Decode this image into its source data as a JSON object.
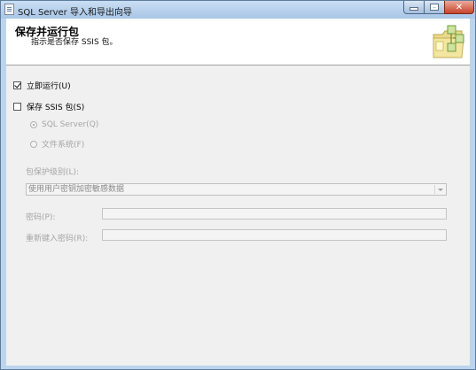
{
  "window": {
    "title": "SQL Server 导入和导出向导",
    "icon": "wizard-app-icon"
  },
  "header": {
    "title": "保存并运行包",
    "subtitle": "指示是否保存 SSIS 包。",
    "icon": "package-folder-icon"
  },
  "options": {
    "run_immediately": {
      "label": "立即运行(U)",
      "checked": true
    },
    "save_package": {
      "label": "保存 SSIS 包(S)",
      "checked": false
    },
    "sql_server": {
      "label": "SQL Server(Q)",
      "selected": true
    },
    "file_system": {
      "label": "文件系统(F)",
      "selected": false
    }
  },
  "protection": {
    "label": "包保护级别(L):",
    "selected": "使用用户密钥加密敏感数据"
  },
  "password": {
    "label": "密码(P):",
    "value": ""
  },
  "retype_password": {
    "label": "重新键入密码(R):",
    "value": ""
  }
}
